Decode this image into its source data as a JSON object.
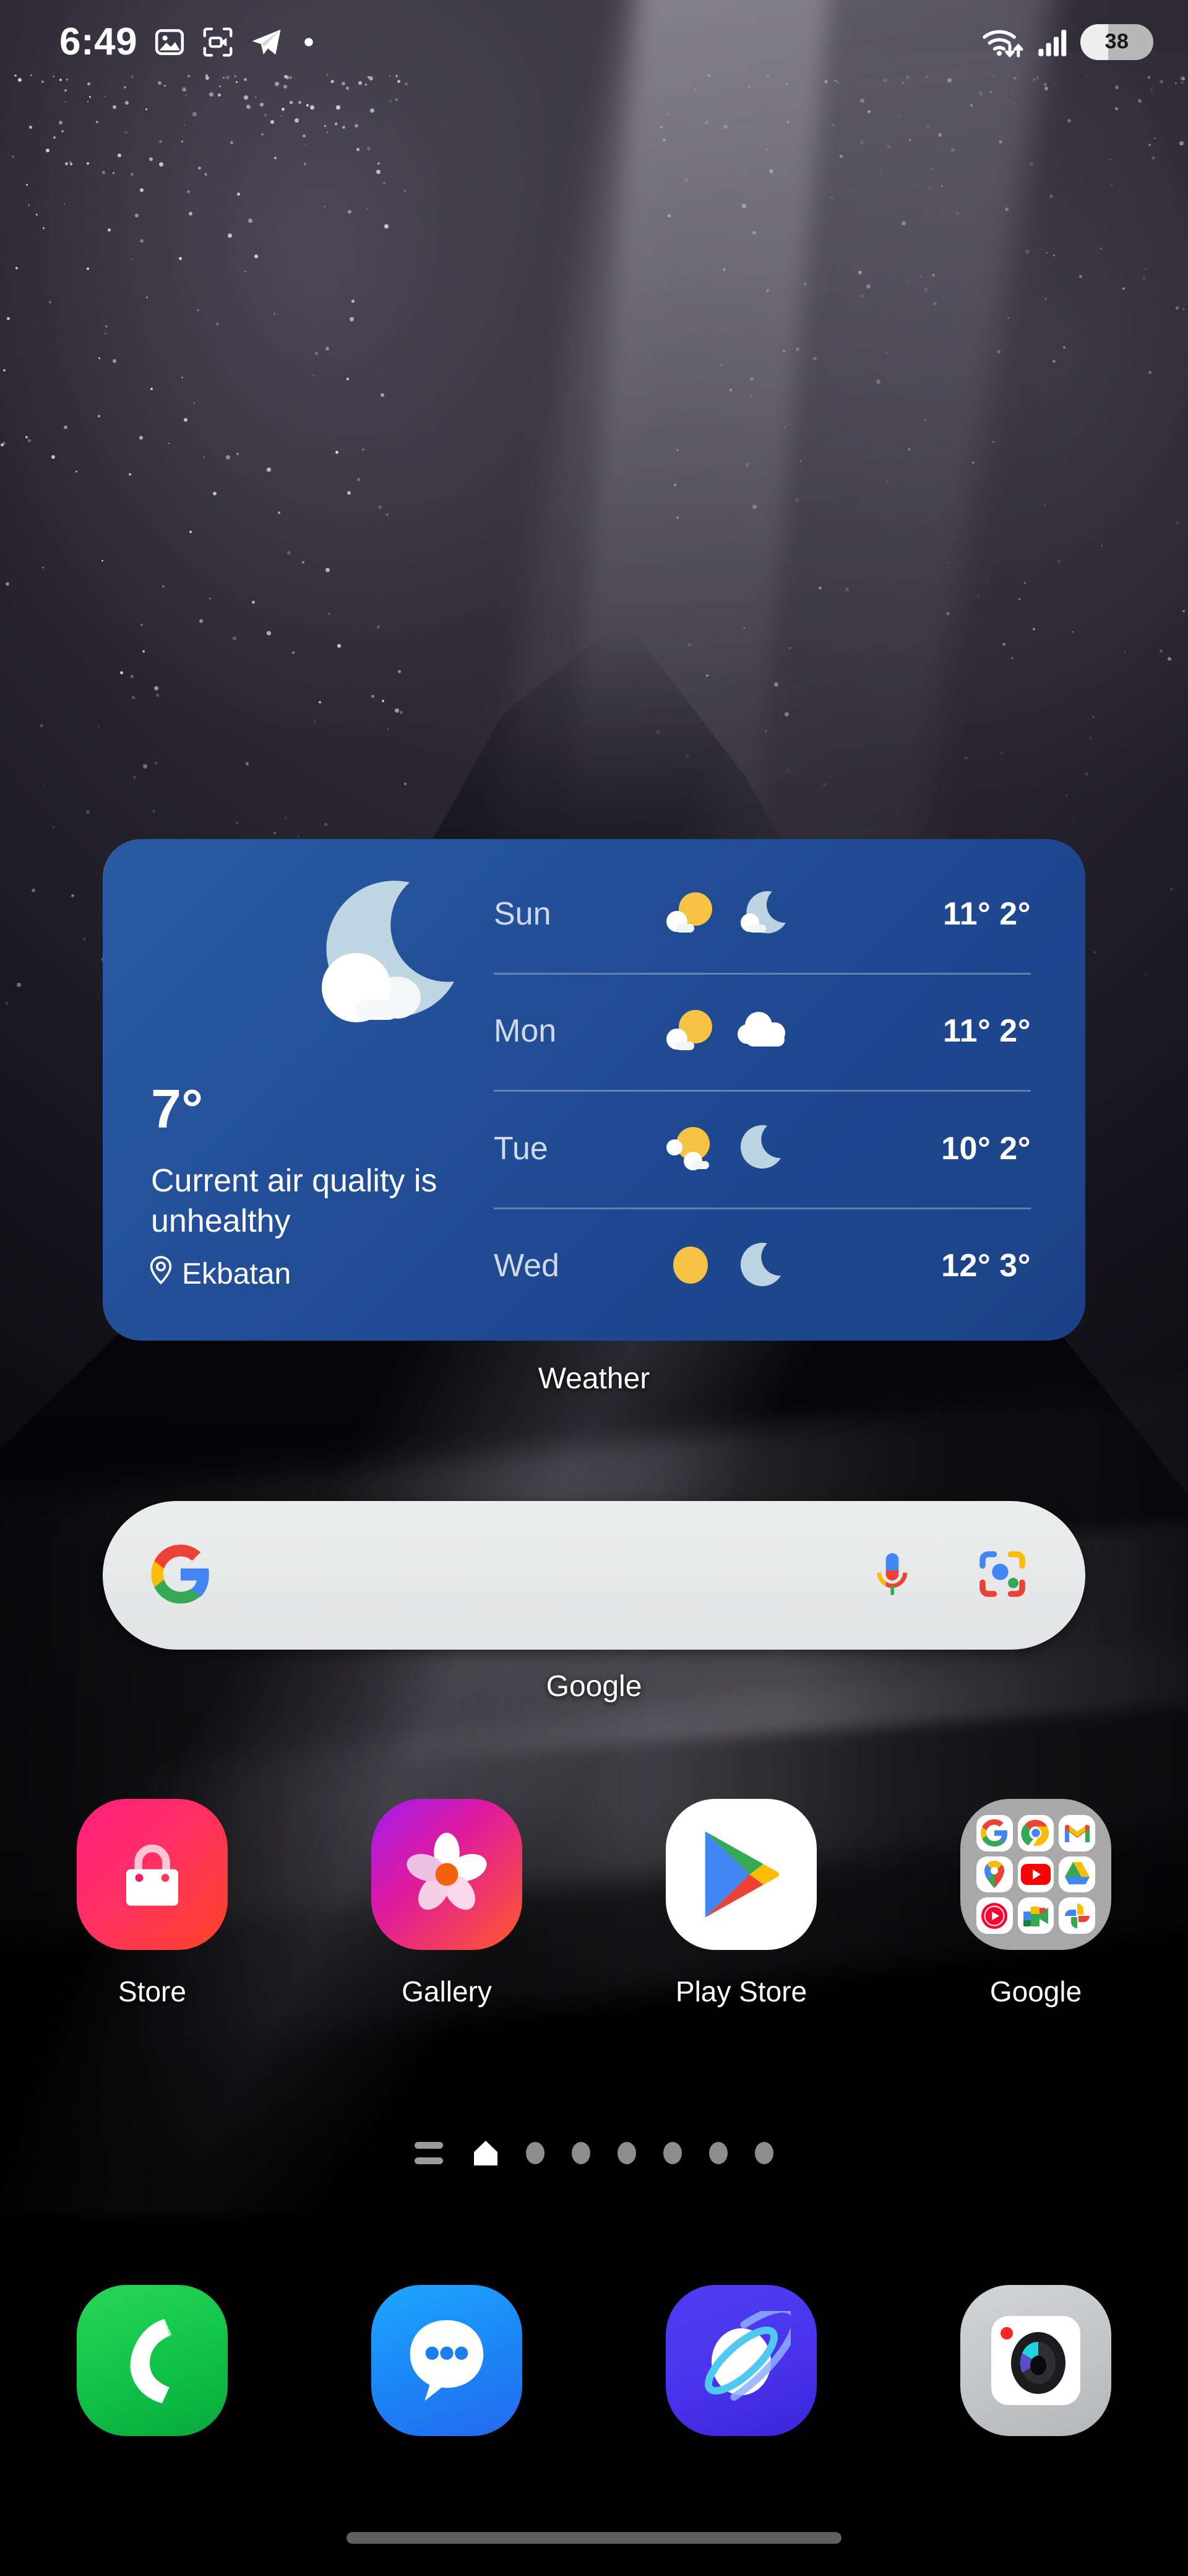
{
  "status_bar": {
    "clock": "6:49",
    "battery_percent": "38",
    "notification_icons": [
      {
        "name": "image-notification-icon",
        "label": "Screenshot saved"
      },
      {
        "name": "screen-record-notification-icon",
        "label": "Screen recorder"
      },
      {
        "name": "telegram-notification-icon",
        "label": "Telegram"
      },
      {
        "name": "dot-notification-icon",
        "label": "More notifications"
      }
    ],
    "system_icons": [
      {
        "name": "wifi-icon",
        "label": "Wi-Fi"
      },
      {
        "name": "cellular-signal-icon",
        "label": "Signal"
      },
      {
        "name": "battery-icon",
        "label": "Battery"
      }
    ]
  },
  "weather_widget": {
    "label": "Weather",
    "current_temp": "7°",
    "condition_icon": "moon-cloud-icon",
    "air_quality_text": "Current air quality is unhealthy",
    "location": "Ekbatan",
    "location_icon": "location-pin-icon",
    "forecast": [
      {
        "day": "Sun",
        "day_icon": "sun-cloud-icon",
        "night_icon": "moon-cloud-icon",
        "high": "11°",
        "low": "2°"
      },
      {
        "day": "Mon",
        "day_icon": "sun-cloud-icon",
        "night_icon": "cloud-icon",
        "high": "11°",
        "low": "2°"
      },
      {
        "day": "Tue",
        "day_icon": "sun-cloud-icon",
        "night_icon": "moon-icon",
        "high": "10°",
        "low": "2°"
      },
      {
        "day": "Wed",
        "day_icon": "sun-icon",
        "night_icon": "moon-icon",
        "high": "12°",
        "low": "3°"
      }
    ],
    "colors": {
      "background": "#1e4890",
      "text": "#ffffff",
      "day_text": "#cfd9e8",
      "sun": "#f6c344",
      "moon": "#bcd4e2"
    }
  },
  "search": {
    "label": "Google",
    "value": "",
    "placeholder": "",
    "logo_icon": "google-g-icon",
    "mic_icon": "microphone-icon",
    "lens_icon": "google-lens-icon"
  },
  "apps": [
    {
      "label": "Store",
      "icon": "store-bag-icon"
    },
    {
      "label": "Gallery",
      "icon": "gallery-flower-icon"
    },
    {
      "label": "Play Store",
      "icon": "play-store-icon"
    },
    {
      "label": "Google",
      "icon": "google-folder-icon"
    }
  ],
  "google_folder": {
    "label": "Google",
    "items": [
      {
        "name": "google-app-icon"
      },
      {
        "name": "chrome-icon"
      },
      {
        "name": "gmail-icon"
      },
      {
        "name": "google-maps-icon"
      },
      {
        "name": "youtube-icon"
      },
      {
        "name": "google-drive-icon"
      },
      {
        "name": "youtube-music-icon"
      },
      {
        "name": "google-meet-icon"
      },
      {
        "name": "google-photos-icon"
      }
    ]
  },
  "page_indicator": {
    "menu_icon": "app-list-icon",
    "home_icon": "home-icon",
    "dot_count": 6,
    "current_page": "home"
  },
  "dock": [
    {
      "label": "Phone",
      "icon": "phone-icon"
    },
    {
      "label": "Messages",
      "icon": "messages-icon"
    },
    {
      "label": "Browser",
      "icon": "browser-planet-icon"
    },
    {
      "label": "Camera",
      "icon": "camera-icon"
    }
  ],
  "navigation": {
    "gesture_bar": "gesture-handle"
  }
}
